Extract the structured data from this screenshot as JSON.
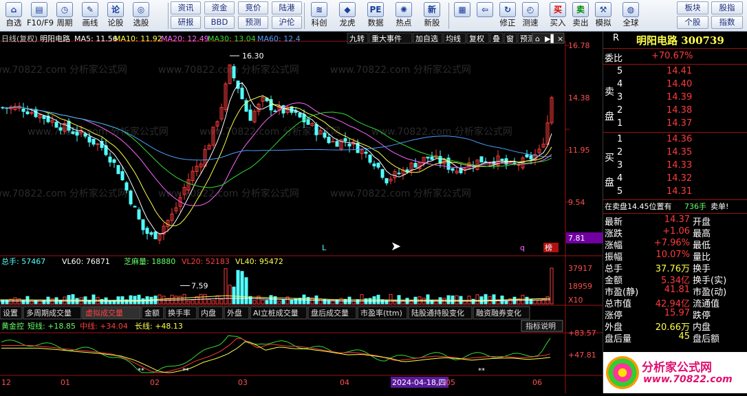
{
  "toolbar": {
    "items": [
      {
        "label": "自选",
        "icon": "home-icon"
      },
      {
        "label": "F10/F9",
        "icon": "news-icon"
      },
      {
        "label": "周期",
        "icon": "clock-icon"
      },
      {
        "label": "画线",
        "icon": "pen-icon"
      },
      {
        "label": "论股",
        "icon": "forum-icon"
      },
      {
        "label": "选股",
        "icon": "gauge-icon"
      }
    ],
    "grid_buttons": [
      [
        "资讯",
        "资金",
        "竞价",
        "陆港"
      ],
      [
        "研报",
        "BBD",
        "预测",
        "沪伦"
      ]
    ],
    "items2": [
      {
        "label": "科创",
        "icon": "kechuang-icon"
      },
      {
        "label": "龙虎",
        "icon": "dragon-icon"
      },
      {
        "label": "数据",
        "icon": "pe-icon"
      },
      {
        "label": "热点",
        "icon": "hot-icon"
      },
      {
        "label": "新股",
        "icon": "ipo-icon"
      }
    ],
    "items3": [
      {
        "label": "",
        "icon": "window-grid-icon"
      },
      {
        "label": "",
        "icon": "back-arrow-icon"
      },
      {
        "label": "修正",
        "icon": "revise-icon"
      },
      {
        "label": "测速",
        "icon": "speed-icon"
      },
      {
        "label": "买入",
        "icon": "buy-icon"
      },
      {
        "label": "卖出",
        "icon": "sell-icon"
      },
      {
        "label": "模拟",
        "icon": "simulate-icon"
      },
      {
        "label": "全球",
        "icon": "globe-icon"
      }
    ],
    "right_buttons": [
      [
        "板块",
        "股指"
      ],
      [
        "个股",
        "指数"
      ]
    ]
  },
  "main_header": {
    "label": "日线(复权)",
    "stock": "明阳电路",
    "ma5": "MA5: 11.56",
    "ma10": "MA10: 11.92",
    "ma20": "MA20: 12.49",
    "ma30": "MA30: 13.04",
    "ma60": "MA60: 12.4",
    "tabs": [
      "九转",
      "重大事件",
      "加自选",
      "均线",
      "复权",
      "叠",
      "窗",
      "预测"
    ]
  },
  "colors": {
    "up": "#ff3b3b",
    "down": "#54ffff",
    "ma5": "#ffffff",
    "ma10": "#ffff4a",
    "ma20": "#ff66ff",
    "ma30": "#33dd33",
    "ma60": "#4aa0ff"
  },
  "price_axis": [
    "16.78",
    "14.38",
    "11.95",
    "9.54",
    "7.81"
  ],
  "candle_labels": {
    "high": "16.30",
    "low": "7.59",
    "mark_l": "L",
    "mark_q": "q",
    "mark_t": "榜"
  },
  "volume_header": {
    "zongshou": "总手: 57467",
    "vl60": "VL60: 76871",
    "zhima": "芝麻量: 18880",
    "vl20": "VL20: 52183",
    "vl40": "VL40: 95472"
  },
  "volume_axis": [
    "37917",
    "18959",
    "X10"
  ],
  "indicator_tabs": [
    "设置",
    "多周期成交量",
    "虚拟成交量",
    "金额",
    "换手率",
    "内盘",
    "外盘",
    "AI立桩成交量",
    "盘后成交量",
    "市盈率(ttm)",
    "陆股通持股变化",
    "融资融券变化"
  ],
  "ind_header": {
    "name": "黄金控",
    "short": "短线: +18.85",
    "mid": "中线: +34.04",
    "long": "长线: +48.13",
    "help": "指标说明"
  },
  "ind_axis": [
    "+83.57",
    "+47.81"
  ],
  "date_axis": [
    "12",
    "01",
    "02",
    "03",
    "04",
    "2024-04-18,四",
    "05",
    "06"
  ],
  "watermark": "www.70822.com 分析家公式网",
  "right_panel": {
    "title": "明阳电路 300739",
    "r_label": "R",
    "weibi_label": "委比",
    "weibi": "+70.67%",
    "sell_label": "卖盘",
    "buy_label": "买盘",
    "sell": [
      [
        "5",
        "14.41"
      ],
      [
        "4",
        "14.40"
      ],
      [
        "3",
        "14.39"
      ],
      [
        "2",
        "14.38"
      ],
      [
        "1",
        "14.37"
      ]
    ],
    "buy": [
      [
        "1",
        "14.36"
      ],
      [
        "2",
        "14.35"
      ],
      [
        "3",
        "14.33"
      ],
      [
        "4",
        "14.32"
      ],
      [
        "5",
        "14.31"
      ]
    ],
    "notice": "在卖盘14.45位置有",
    "notice_qty": "736手",
    "notice_tag": "卖单!",
    "stats": [
      [
        "最新",
        "14.37",
        "开盘",
        ""
      ],
      [
        "涨跌",
        "+1.06",
        "最高",
        ""
      ],
      [
        "涨幅",
        "+7.96%",
        "最低",
        ""
      ],
      [
        "振幅",
        "10.07%",
        "量比",
        ""
      ],
      [
        "总手",
        "37.76万",
        "换手",
        ""
      ],
      [
        "金额",
        "5.34亿",
        "换手(实)",
        ""
      ],
      [
        "市盈(静)",
        "41.81",
        "市盈(动)",
        ""
      ],
      [
        "总市值",
        "42.94亿",
        "流通值",
        ""
      ],
      [
        "涨停",
        "15.97",
        "跌停",
        ""
      ],
      [
        "外盘",
        "20.66万",
        "内盘",
        ""
      ],
      [
        "盘后量",
        "45",
        "盘后额",
        ""
      ]
    ],
    "logo_text": "分析家公式网",
    "logo_url": "www.70822.com"
  }
}
